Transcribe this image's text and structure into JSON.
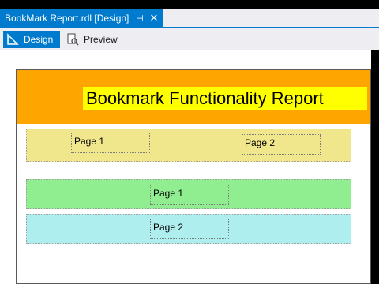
{
  "document_tab": {
    "title": "BookMark Report.rdl [Design]",
    "pin_glyph": "⊣",
    "close_glyph": "✕"
  },
  "toolbar": {
    "design_label": "Design",
    "preview_label": "Preview"
  },
  "report": {
    "title": "Bookmark Functionality Report",
    "band1": {
      "left_label": "Page 1",
      "right_label": "Page 2"
    },
    "band2": {
      "label": "Page 1"
    },
    "band3": {
      "label": "Page 2"
    }
  },
  "colors": {
    "tab_active": "#007acc",
    "header_band": "#ffa500",
    "title_box": "#ffff00",
    "band1": "#f0e68c",
    "band2": "#90ee90",
    "band3": "#afeeee"
  }
}
